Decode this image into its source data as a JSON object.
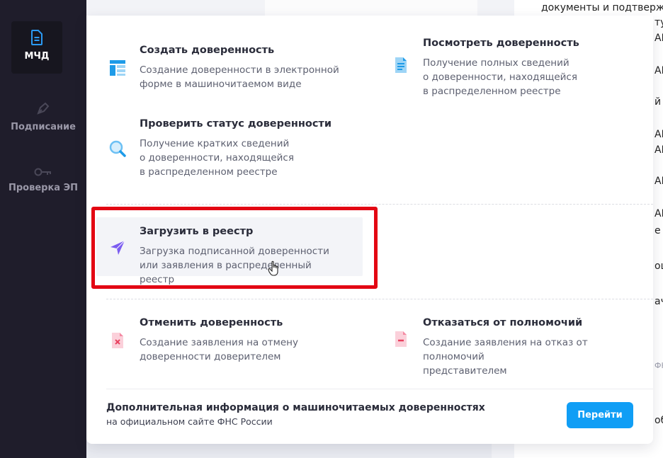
{
  "sidebar": {
    "items": [
      {
        "label": "МЧД",
        "icon": "document-icon"
      },
      {
        "label": "Подписание",
        "icon": "pen-icon"
      },
      {
        "label": "Проверка ЭП",
        "icon": "key-icon"
      }
    ]
  },
  "background": {
    "right_lines": [
      "документы и подтверж,",
      "туд",
      "AL",
      "AL",
      "й",
      "AL",
      "AL",
      "AL",
      "AL",
      "е",
      "ош",
      "ач",
      "ФН",
      "об"
    ]
  },
  "menu": {
    "create": {
      "title": "Создать доверенность",
      "desc": "Создание доверенности в электронной\nформе в машиночитаемом виде",
      "icon": "form-icon"
    },
    "view": {
      "title": "Посмотреть доверенность",
      "desc": "Получение полных сведений\nо доверенности, находящейся\nв распределенном реестре",
      "icon": "file-text-icon"
    },
    "status": {
      "title": "Проверить статус доверенности",
      "desc": "Получение кратких сведений\nо доверенности, находящейся\nв распределенном реестре",
      "icon": "magnifier-icon"
    },
    "upload": {
      "title": "Загрузить в реестр",
      "desc": "Загрузка подписанной доверенности\nили заявления в распределенный реестр",
      "icon": "send-icon"
    },
    "cancel": {
      "title": "Отменить доверенность",
      "desc": "Создание заявления на отмену\nдоверенности доверителем",
      "icon": "file-cancel-icon"
    },
    "refuse": {
      "title": "Отказаться от полномочий",
      "desc": "Создание заявления на отказ от полномочий\nпредставителем",
      "icon": "file-minus-icon"
    }
  },
  "footer": {
    "title": "Дополнительная информация о машиночитаемых доверенностях",
    "subtitle": "на официальном сайте ФНС России",
    "button_label": "Перейти"
  },
  "colors": {
    "sidebar_bg": "#1f1d2b",
    "accent_blue": "#109ef5",
    "highlight_red": "#e30613",
    "send_purple": "#7b5cf0",
    "doc_pink": "#f48aa2"
  }
}
